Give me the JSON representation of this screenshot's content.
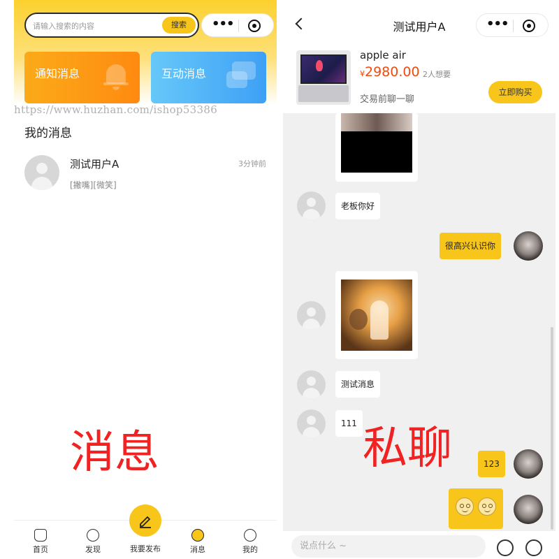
{
  "left": {
    "search": {
      "placeholder": "请输入搜索的内容",
      "button": "搜索"
    },
    "cards": {
      "notify": "通知消息",
      "interact": "互动消息"
    },
    "watermark": "https://www.huzhan.com/ishop53386",
    "section_title": "我的消息",
    "messages": [
      {
        "name": "测试用户A",
        "time": "3分钟前",
        "preview": "[撇嘴][微笑]"
      }
    ],
    "overlay_label": "消息",
    "tabs": [
      "首页",
      "发现",
      "我要发布",
      "消息",
      "我的"
    ]
  },
  "right": {
    "title": "测试用户A",
    "product": {
      "name": "apple air",
      "currency": "¥",
      "price": "2980.00",
      "wants": "2人想要",
      "chat_prompt": "交易前聊一聊",
      "buy_button": "立即购买"
    },
    "chat": [
      {
        "from": "other",
        "text": "老板你好"
      },
      {
        "from": "me",
        "text": "很高兴认识你"
      },
      {
        "from": "other",
        "text": "测试消息"
      },
      {
        "from": "other",
        "text": "111"
      },
      {
        "from": "me",
        "text": "123"
      }
    ],
    "overlay_label": "私聊",
    "input_placeholder": "说点什么 ~"
  },
  "colors": {
    "accent": "#f8c51a",
    "price": "#f04a0f",
    "overlay": "#f02222"
  },
  "icons": [
    "search-icon",
    "more-dots-icon",
    "target-icon",
    "bell-icon",
    "chat-icon",
    "home-icon",
    "compass-icon",
    "pen-icon",
    "message-icon",
    "profile-icon",
    "back-icon",
    "emoji-icon",
    "image-icon"
  ]
}
